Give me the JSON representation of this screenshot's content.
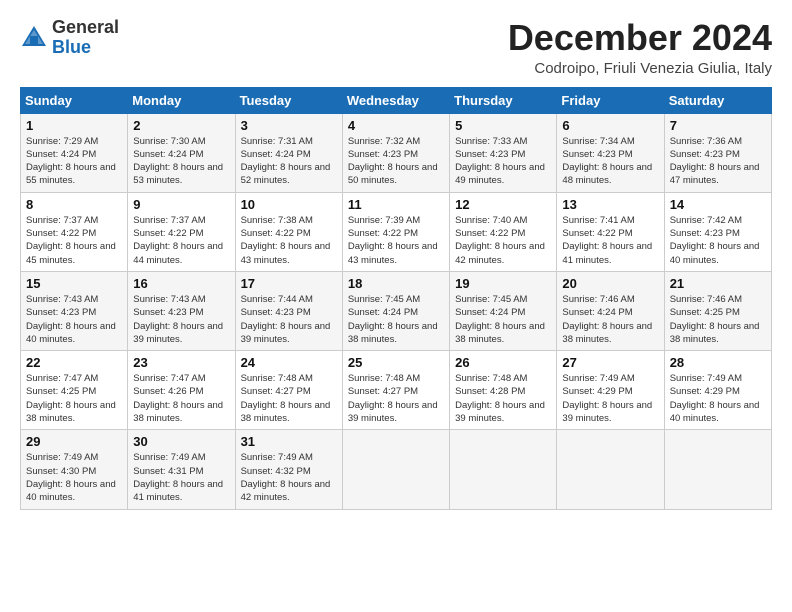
{
  "header": {
    "logo_general": "General",
    "logo_blue": "Blue",
    "month_title": "December 2024",
    "location": "Codroipo, Friuli Venezia Giulia, Italy"
  },
  "weekdays": [
    "Sunday",
    "Monday",
    "Tuesday",
    "Wednesday",
    "Thursday",
    "Friday",
    "Saturday"
  ],
  "weeks": [
    [
      {
        "day": "1",
        "sunrise": "7:29 AM",
        "sunset": "4:24 PM",
        "daylight": "8 hours and 55 minutes."
      },
      {
        "day": "2",
        "sunrise": "7:30 AM",
        "sunset": "4:24 PM",
        "daylight": "8 hours and 53 minutes."
      },
      {
        "day": "3",
        "sunrise": "7:31 AM",
        "sunset": "4:24 PM",
        "daylight": "8 hours and 52 minutes."
      },
      {
        "day": "4",
        "sunrise": "7:32 AM",
        "sunset": "4:23 PM",
        "daylight": "8 hours and 50 minutes."
      },
      {
        "day": "5",
        "sunrise": "7:33 AM",
        "sunset": "4:23 PM",
        "daylight": "8 hours and 49 minutes."
      },
      {
        "day": "6",
        "sunrise": "7:34 AM",
        "sunset": "4:23 PM",
        "daylight": "8 hours and 48 minutes."
      },
      {
        "day": "7",
        "sunrise": "7:36 AM",
        "sunset": "4:23 PM",
        "daylight": "8 hours and 47 minutes."
      }
    ],
    [
      {
        "day": "8",
        "sunrise": "7:37 AM",
        "sunset": "4:22 PM",
        "daylight": "8 hours and 45 minutes."
      },
      {
        "day": "9",
        "sunrise": "7:37 AM",
        "sunset": "4:22 PM",
        "daylight": "8 hours and 44 minutes."
      },
      {
        "day": "10",
        "sunrise": "7:38 AM",
        "sunset": "4:22 PM",
        "daylight": "8 hours and 43 minutes."
      },
      {
        "day": "11",
        "sunrise": "7:39 AM",
        "sunset": "4:22 PM",
        "daylight": "8 hours and 43 minutes."
      },
      {
        "day": "12",
        "sunrise": "7:40 AM",
        "sunset": "4:22 PM",
        "daylight": "8 hours and 42 minutes."
      },
      {
        "day": "13",
        "sunrise": "7:41 AM",
        "sunset": "4:22 PM",
        "daylight": "8 hours and 41 minutes."
      },
      {
        "day": "14",
        "sunrise": "7:42 AM",
        "sunset": "4:23 PM",
        "daylight": "8 hours and 40 minutes."
      }
    ],
    [
      {
        "day": "15",
        "sunrise": "7:43 AM",
        "sunset": "4:23 PM",
        "daylight": "8 hours and 40 minutes."
      },
      {
        "day": "16",
        "sunrise": "7:43 AM",
        "sunset": "4:23 PM",
        "daylight": "8 hours and 39 minutes."
      },
      {
        "day": "17",
        "sunrise": "7:44 AM",
        "sunset": "4:23 PM",
        "daylight": "8 hours and 39 minutes."
      },
      {
        "day": "18",
        "sunrise": "7:45 AM",
        "sunset": "4:24 PM",
        "daylight": "8 hours and 38 minutes."
      },
      {
        "day": "19",
        "sunrise": "7:45 AM",
        "sunset": "4:24 PM",
        "daylight": "8 hours and 38 minutes."
      },
      {
        "day": "20",
        "sunrise": "7:46 AM",
        "sunset": "4:24 PM",
        "daylight": "8 hours and 38 minutes."
      },
      {
        "day": "21",
        "sunrise": "7:46 AM",
        "sunset": "4:25 PM",
        "daylight": "8 hours and 38 minutes."
      }
    ],
    [
      {
        "day": "22",
        "sunrise": "7:47 AM",
        "sunset": "4:25 PM",
        "daylight": "8 hours and 38 minutes."
      },
      {
        "day": "23",
        "sunrise": "7:47 AM",
        "sunset": "4:26 PM",
        "daylight": "8 hours and 38 minutes."
      },
      {
        "day": "24",
        "sunrise": "7:48 AM",
        "sunset": "4:27 PM",
        "daylight": "8 hours and 38 minutes."
      },
      {
        "day": "25",
        "sunrise": "7:48 AM",
        "sunset": "4:27 PM",
        "daylight": "8 hours and 39 minutes."
      },
      {
        "day": "26",
        "sunrise": "7:48 AM",
        "sunset": "4:28 PM",
        "daylight": "8 hours and 39 minutes."
      },
      {
        "day": "27",
        "sunrise": "7:49 AM",
        "sunset": "4:29 PM",
        "daylight": "8 hours and 39 minutes."
      },
      {
        "day": "28",
        "sunrise": "7:49 AM",
        "sunset": "4:29 PM",
        "daylight": "8 hours and 40 minutes."
      }
    ],
    [
      {
        "day": "29",
        "sunrise": "7:49 AM",
        "sunset": "4:30 PM",
        "daylight": "8 hours and 40 minutes."
      },
      {
        "day": "30",
        "sunrise": "7:49 AM",
        "sunset": "4:31 PM",
        "daylight": "8 hours and 41 minutes."
      },
      {
        "day": "31",
        "sunrise": "7:49 AM",
        "sunset": "4:32 PM",
        "daylight": "8 hours and 42 minutes."
      },
      null,
      null,
      null,
      null
    ]
  ]
}
